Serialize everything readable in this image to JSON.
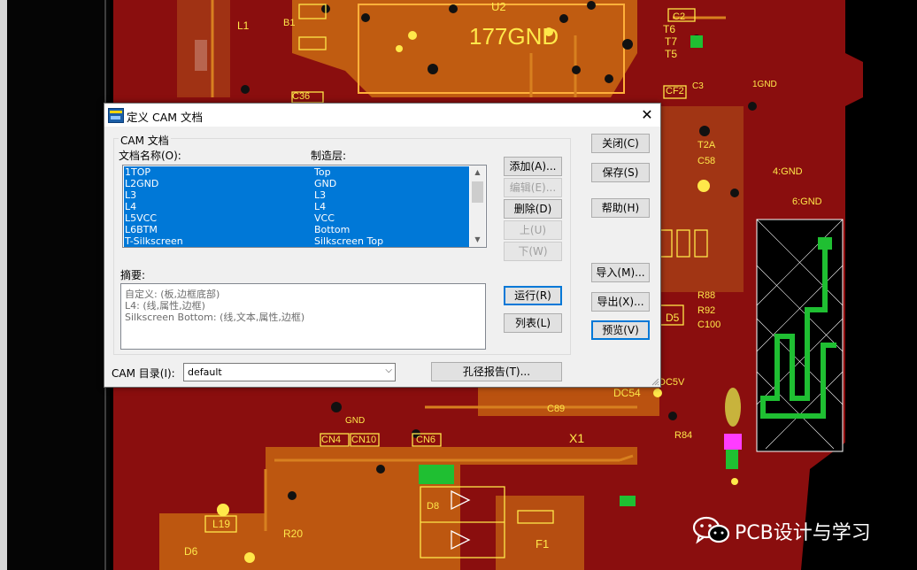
{
  "background": {
    "labels": [
      "U2",
      "177GND",
      "L1",
      "T6",
      "T7",
      "T5",
      "C2",
      "B1",
      "C36",
      "CF2",
      "C3",
      "1GND",
      "4:GND",
      "6:GND",
      "T2A",
      "C58",
      "DC5V",
      "C89",
      "DC54",
      "X1",
      "GND",
      "CN4",
      "CN10",
      "CN6",
      "L19",
      "D6",
      "R20",
      "F1",
      "D8",
      "D5",
      "C100",
      "R88",
      "R92",
      "R84"
    ]
  },
  "dialog": {
    "title": "定义 CAM 文档",
    "group_title": "CAM 文档",
    "col_name_header": "文档名称(O):",
    "col_layer_header": "制造层:",
    "rows": [
      {
        "name": "1TOP",
        "layer": "Top"
      },
      {
        "name": "L2GND",
        "layer": "GND"
      },
      {
        "name": "L3",
        "layer": "L3"
      },
      {
        "name": "L4",
        "layer": "L4"
      },
      {
        "name": "L5VCC",
        "layer": "VCC"
      },
      {
        "name": "L6BTM",
        "layer": "Bottom"
      },
      {
        "name": "T-Silkscreen",
        "layer": "Silkscreen Top"
      }
    ],
    "buttons": {
      "add": "添加(A)...",
      "edit": "编辑(E)...",
      "delete": "删除(D)",
      "up": "上(U)",
      "down": "下(W)",
      "run": "运行(R)",
      "list": "列表(L)",
      "close": "关闭(C)",
      "save": "保存(S)",
      "help": "帮助(H)",
      "import": "导入(M)...",
      "export": "导出(X)...",
      "preview": "预览(V)",
      "drill_report": "孔径报告(T)..."
    },
    "summary_label": "摘要:",
    "summary_lines": [
      "自定义: (板,边框底部)",
      "L4: (线,属性,边框)",
      "Silkscreen Bottom: (线,文本,属性,边框)"
    ],
    "cam_dir_label": "CAM 目录(I):",
    "cam_dir_value": "default"
  },
  "watermark": {
    "text": "PCB设计与学习"
  },
  "colors": {
    "board": "#8a0e0e",
    "copper": "#c96a12",
    "selection": "#0078d7",
    "silk": "#ffe84a"
  }
}
